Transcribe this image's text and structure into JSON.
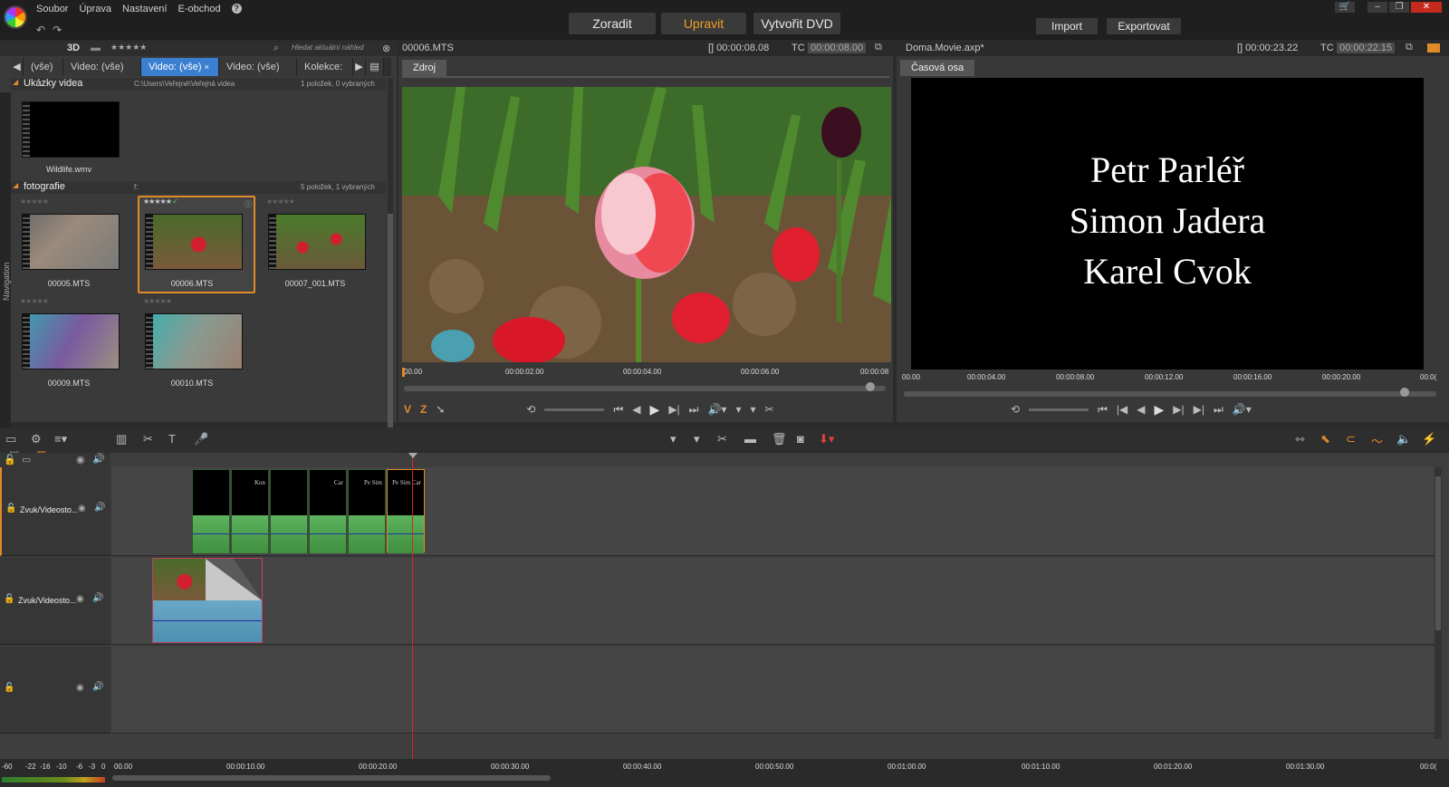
{
  "menu": {
    "items": [
      "Soubor",
      "Úprava",
      "Nastavení",
      "E-obchod"
    ],
    "help": "?"
  },
  "modes": {
    "organize": "Zoradit",
    "edit": "Upravit",
    "dvd": "Vytvořit DVD"
  },
  "actions": {
    "import": "Import",
    "export": "Exportovat"
  },
  "library": {
    "mode3d": "3D",
    "rating": "★★★★★",
    "search_placeholder": "Hledat aktuální náhled",
    "tabs": [
      "(vše)",
      "Video: (vše)",
      "Video: (vše)",
      "Video: (vše)",
      "Kolekce: P"
    ],
    "selected_tab": 2,
    "sections": [
      {
        "name": "Ukázky videa",
        "path": "C:\\Users\\Veřejné\\Veřejná videa",
        "count": "1 položek, 0 vybraných"
      },
      {
        "name": "fotografie",
        "path": "f:",
        "count": "5 položek, 1 vybraných"
      }
    ],
    "items": [
      {
        "name": "Wildlife.wmv"
      },
      {
        "name": "00005.MTS"
      },
      {
        "name": "00006.MTS"
      },
      {
        "name": "00007_001.MTS"
      },
      {
        "name": "00009.MTS"
      },
      {
        "name": "00010.MTS"
      }
    ],
    "nav_label": "Navigation"
  },
  "source": {
    "filename": "00006.MTS",
    "duration": "[] 00:00:08.08",
    "tc_label": "TC",
    "tc_value": "00:00:08.00",
    "tab": "Zdroj",
    "ruler": [
      "00.00",
      "00:00:02.00",
      "00:00:04.00",
      "00:00:06.00",
      "00:00:08"
    ],
    "mark_in": "V",
    "mark_out": "Z"
  },
  "program": {
    "filename": "Doma.Movie.axp*",
    "duration": "[] 00:00:23.22",
    "tc_label": "TC",
    "tc_value": "00:00:22.15",
    "tab": "Časová osa",
    "title_lines": [
      "Petr Parléř",
      "Simon Jadera",
      "Karel Cvok"
    ],
    "ruler": [
      "00.00",
      "00:00:04.00",
      "00:00:08.00",
      "00:00:12.00",
      "00:00:16.00",
      "00:00:20.00",
      "00:0("
    ]
  },
  "timeline": {
    "tracks": [
      {
        "name": "Zvuk/Videosto..."
      },
      {
        "name": "Zvuk/Videosto..."
      },
      {
        "name": ""
      }
    ],
    "clip_texts": [
      "",
      "Kon",
      "",
      "Car",
      "Pe Sim",
      "Pe Sim Car"
    ],
    "ruler": [
      "00.00",
      "00:00:10.00",
      "00:00:20.00",
      "00:00:30.00",
      "00:00:40.00",
      "00:00:50.00",
      "00:01:00.00",
      "00:01:10.00",
      "00:01:20.00",
      "00:01:30.00",
      "00:0("
    ],
    "vu_scale": [
      "-60",
      "-22",
      "-16",
      "-10",
      "-6",
      "-3",
      "0"
    ]
  },
  "colors": {
    "accent": "#e08a2a",
    "selection_tab": "#3b7fd0",
    "playhead": "#e02020"
  }
}
